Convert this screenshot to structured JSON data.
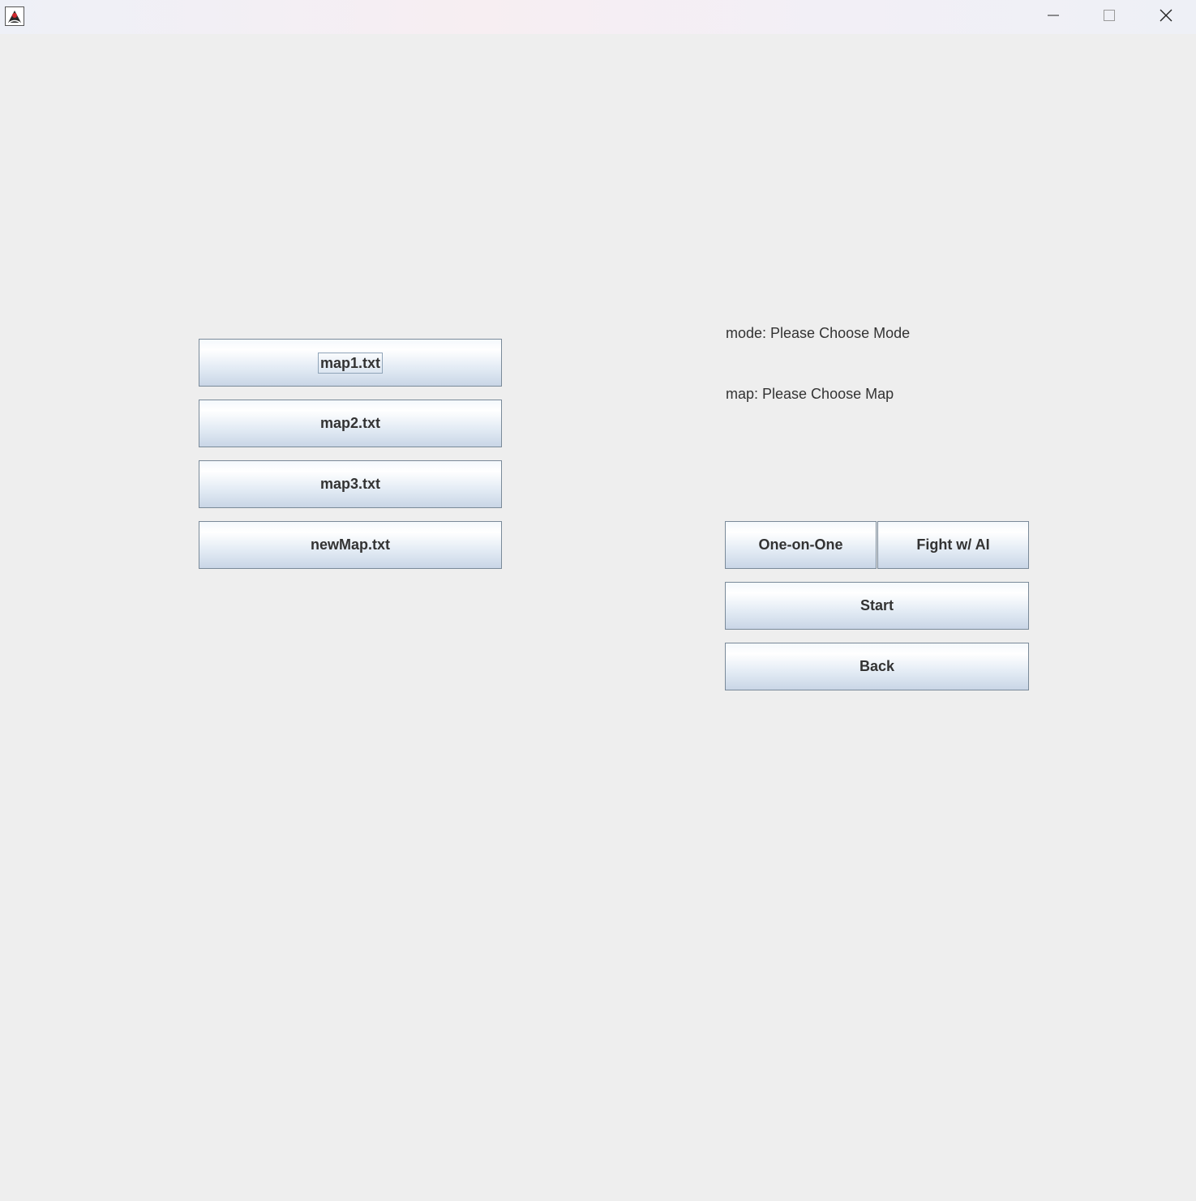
{
  "titlebar": {
    "app_icon": "java-duke-icon",
    "minimize_icon": "minimize-icon",
    "maximize_icon": "maximize-icon",
    "close_icon": "close-icon"
  },
  "maps": {
    "buttons": [
      {
        "label": "map1.txt"
      },
      {
        "label": "map2.txt"
      },
      {
        "label": "map3.txt"
      },
      {
        "label": "newMap.txt"
      }
    ]
  },
  "status": {
    "mode_text": "mode: Please Choose Mode",
    "map_text": "map: Please Choose Map"
  },
  "controls": {
    "one_on_one_label": "One-on-One",
    "fight_ai_label": "Fight w/ AI",
    "start_label": "Start",
    "back_label": "Back"
  },
  "colors": {
    "background": "#eeeeee",
    "button_border": "#7a8a99",
    "text": "#333333"
  }
}
